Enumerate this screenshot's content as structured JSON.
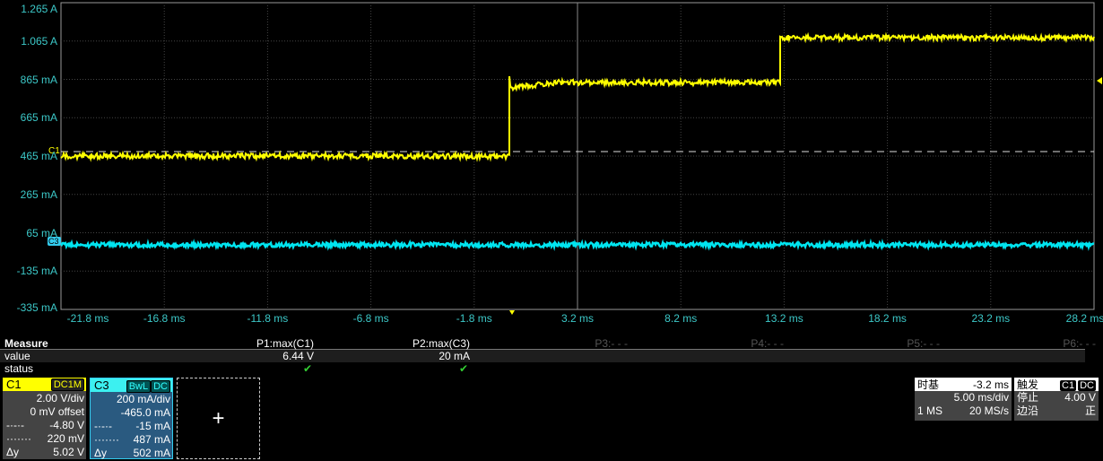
{
  "y_axis_labels": [
    "1.265 A",
    "1.065 A",
    "865 mA",
    "665 mA",
    "465 mA",
    "265 mA",
    "65 mA",
    "-135 mA",
    "-335 mA"
  ],
  "x_axis_labels": [
    "-21.8 ms",
    "-16.8 ms",
    "-11.8 ms",
    "-6.8 ms",
    "-1.8 ms",
    "3.2 ms",
    "8.2 ms",
    "13.2 ms",
    "18.2 ms",
    "23.2 ms",
    "28.2 ms"
  ],
  "channel_markers": {
    "c1": "C1",
    "c3": "C3"
  },
  "colors": {
    "c1": "#ffff00",
    "c3": "#00e5f0",
    "axis_text": "#3cc8c8",
    "grid": "#555555"
  },
  "measure": {
    "title": "Measure",
    "value_label": "value",
    "status_label": "status",
    "params": [
      {
        "name": "P1:max(C1)",
        "value": "6.44 V",
        "status": "✔"
      },
      {
        "name": "P2:max(C3)",
        "value": "20 mA",
        "status": "✔"
      },
      {
        "name": "P3:- - -"
      },
      {
        "name": "P4:- - -"
      },
      {
        "name": "P5:- - -"
      },
      {
        "name": "P6:- - -"
      }
    ]
  },
  "c1": {
    "name": "C1",
    "coupling": "DC1M",
    "scale": "2.00 V/div",
    "offset": "0 mV offset",
    "cursor1_sym": "-·-·-",
    "cursor1": "-4.80 V",
    "cursor2_sym": "·······",
    "cursor2": "220 mV",
    "delta_label": "Δy",
    "delta": "5.02 V"
  },
  "c3": {
    "name": "C3",
    "bw": "BwL",
    "coupling": "DC",
    "scale": "200 mA/div",
    "offset": "-465.0 mA",
    "cursor1_sym": "-·-·-",
    "cursor1": "-15 mA",
    "cursor2_sym": "·······",
    "cursor2": "487 mA",
    "delta_label": "Δy",
    "delta": "502 mA"
  },
  "add_button": "+",
  "timebase": {
    "label": "时基",
    "delay": "-3.2 ms",
    "scale": "5.00 ms/div",
    "points": "1 MS",
    "rate": "20 MS/s"
  },
  "trigger": {
    "label": "触发",
    "source": "C1",
    "coupling": "DC",
    "mode_label": "停止",
    "level": "4.00 V",
    "type_label": "边沿",
    "slope": "正"
  }
}
